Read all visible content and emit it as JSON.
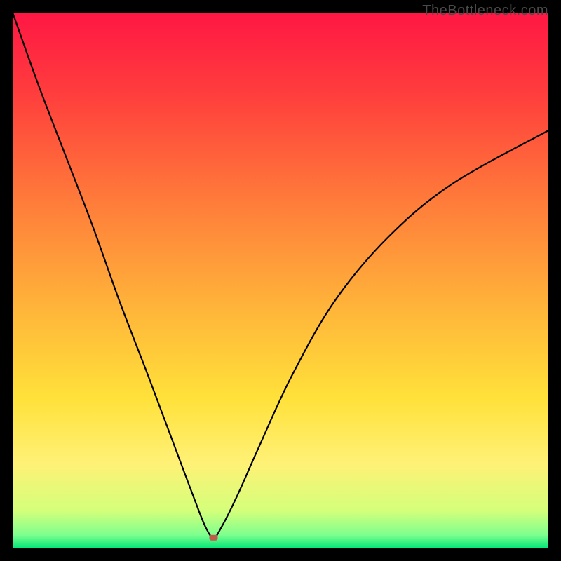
{
  "watermark": "TheBottleneck.com",
  "chart_data": {
    "type": "line",
    "title": "",
    "xlabel": "",
    "ylabel": "",
    "xlim": [
      0,
      100
    ],
    "ylim": [
      0,
      100
    ],
    "background": "heatmap-gradient",
    "gradient_stops": [
      {
        "offset": 0,
        "color": "#ff1744"
      },
      {
        "offset": 0.15,
        "color": "#ff3d3d"
      },
      {
        "offset": 0.35,
        "color": "#ff7b3a"
      },
      {
        "offset": 0.55,
        "color": "#ffb43a"
      },
      {
        "offset": 0.72,
        "color": "#ffe13a"
      },
      {
        "offset": 0.84,
        "color": "#fff176"
      },
      {
        "offset": 0.93,
        "color": "#d4ff7a"
      },
      {
        "offset": 0.975,
        "color": "#7eff8e"
      },
      {
        "offset": 1.0,
        "color": "#00e676"
      }
    ],
    "marker": {
      "x": 37.5,
      "y": 2,
      "color": "#c05a4a"
    },
    "series": [
      {
        "name": "bottleneck-curve",
        "x": [
          0,
          5,
          10,
          15,
          20,
          25,
          28,
          31,
          34,
          36,
          37.5,
          39,
          42,
          46,
          52,
          60,
          70,
          82,
          100
        ],
        "y": [
          100,
          86,
          73,
          60,
          46,
          33,
          25,
          17,
          9,
          4,
          2,
          4,
          10,
          19,
          32,
          46,
          58,
          68,
          78
        ]
      }
    ]
  }
}
